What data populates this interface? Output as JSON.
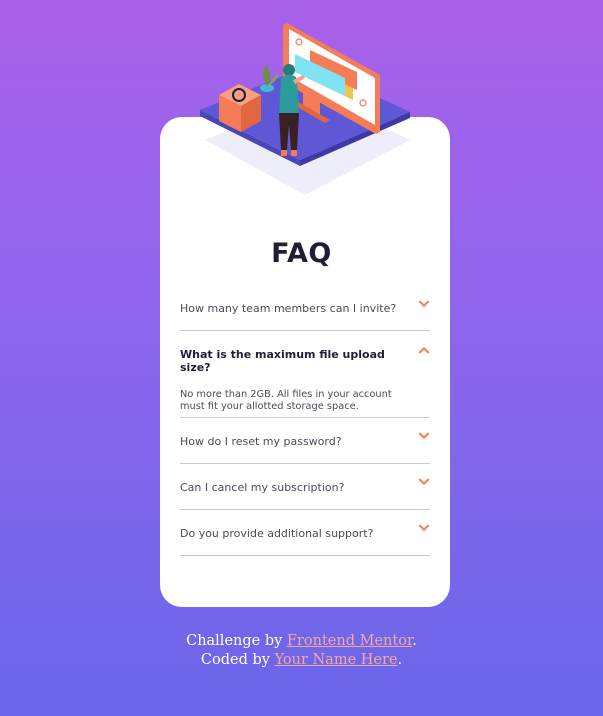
{
  "page": {
    "title": "FAQ"
  },
  "faq": [
    {
      "question": "How many team members can I invite?",
      "open": false
    },
    {
      "question": "What is the maximum file upload size?",
      "open": true,
      "answer": "No more than 2GB. All files in your account must fit your allotted storage space."
    },
    {
      "question": "How do I reset my password?",
      "open": false
    },
    {
      "question": "Can I cancel my subscription?",
      "open": false
    },
    {
      "question": "Do you provide additional support?",
      "open": false
    }
  ],
  "footer": {
    "line1_prefix": "Challenge by ",
    "line1_link": "Frontend Mentor",
    "line1_suffix": ".",
    "line2_prefix": "Coded by ",
    "line2_link": "Your Name Here",
    "line2_suffix": "."
  },
  "colors": {
    "accent": "#f47c57",
    "bg_top": "#a960ea",
    "bg_bottom": "#6a66e9",
    "title": "#1e1f36",
    "link": "#f5a9a0"
  },
  "icons": {
    "collapsed": "chevron-down-icon",
    "expanded": "chevron-up-icon"
  }
}
